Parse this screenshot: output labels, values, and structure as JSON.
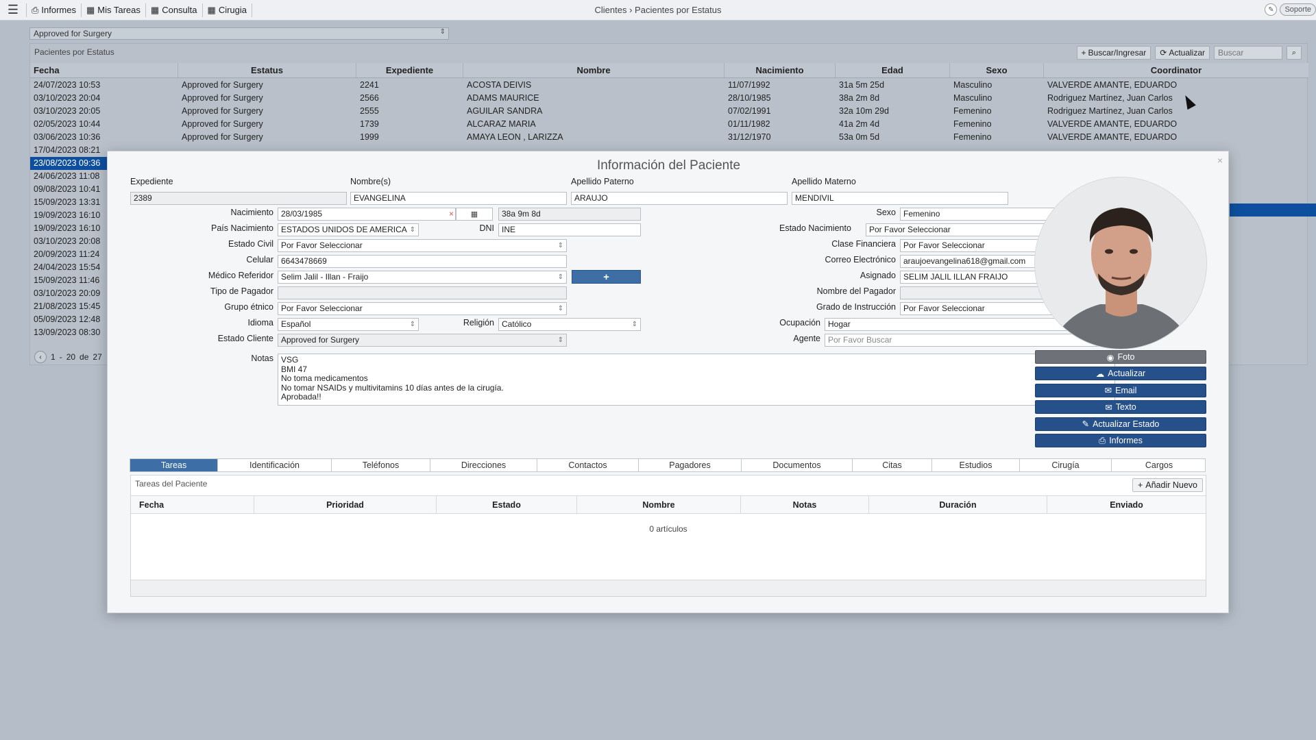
{
  "topbar": {
    "nav": [
      {
        "icon": "print-icon",
        "label": "Informes"
      },
      {
        "icon": "calendar-icon",
        "label": "Mis Tareas"
      },
      {
        "icon": "calendar-icon",
        "label": "Consulta"
      },
      {
        "icon": "calendar-icon",
        "label": "Cirugia"
      }
    ],
    "breadcrumb_parent": "Clientes",
    "breadcrumb_sep": "›",
    "breadcrumb_current": "Pacientes por Estatus",
    "support_label": "Soporte"
  },
  "status_filter": {
    "value": "Approved for Surgery"
  },
  "background_grid": {
    "title": "Pacientes por Estatus",
    "search_label": "Buscar/Ingresar",
    "refresh_label": "Actualizar",
    "search_placeholder": "Buscar",
    "columns": [
      "Fecha",
      "Estatus",
      "Expediente",
      "Nombre",
      "Nacimiento",
      "Edad",
      "Sexo",
      "Coordinator"
    ],
    "rows": [
      [
        "24/07/2023 10:53",
        "Approved for Surgery",
        "2241",
        "ACOSTA DEIVIS",
        "11/07/1992",
        "31a 5m 25d",
        "Masculino",
        "VALVERDE AMANTE, EDUARDO"
      ],
      [
        "03/10/2023 20:04",
        "Approved for Surgery",
        "2566",
        "ADAMS MAURICE",
        "28/10/1985",
        "38a 2m 8d",
        "Masculino",
        "Rodriguez Martínez, Juan Carlos"
      ],
      [
        "03/10/2023 20:05",
        "Approved for Surgery",
        "2555",
        "AGUILAR SANDRA",
        "07/02/1991",
        "32a 10m 29d",
        "Femenino",
        "Rodriguez Martínez, Juan Carlos"
      ],
      [
        "02/05/2023 10:44",
        "Approved for Surgery",
        "1739",
        "ALCARAZ MARIA",
        "01/11/1982",
        "41a 2m 4d",
        "Femenino",
        "VALVERDE AMANTE, EDUARDO"
      ],
      [
        "03/06/2023 10:36",
        "Approved for Surgery",
        "1999",
        "AMAYA LEON , LARIZZA",
        "31/12/1970",
        "53a 0m 5d",
        "Femenino",
        "VALVERDE AMANTE, EDUARDO"
      ]
    ],
    "hidden_dates": [
      "17/04/2023 08:21",
      "23/08/2023 09:36",
      "24/06/2023 11:08",
      "09/08/2023 10:41",
      "15/09/2023 13:31",
      "19/09/2023 16:10",
      "19/09/2023 16:10",
      "03/10/2023 20:08",
      "20/09/2023 11:24",
      "24/04/2023 15:54",
      "15/09/2023 11:46",
      "03/10/2023 20:09",
      "21/08/2023 15:45",
      "05/09/2023 12:48",
      "13/09/2023 08:30"
    ],
    "pager": {
      "from": "1",
      "dash": "-",
      "to": "20",
      "of_label": "de",
      "total": "27"
    }
  },
  "modal": {
    "title": "Información del Paciente",
    "labels": {
      "expediente": "Expediente",
      "nombres": "Nombre(s)",
      "apellido_paterno": "Apellido Paterno",
      "apellido_materno": "Apellido Materno",
      "nacimiento": "Nacimiento",
      "sexo": "Sexo",
      "pais_nacimiento": "País Nacimiento",
      "dni": "DNI",
      "estado_nacimiento": "Estado Nacimiento",
      "estado_civil": "Estado Civil",
      "clase_financiera": "Clase Financiera",
      "celular": "Celular",
      "correo": "Correo Electrónico",
      "medico_referidor": "Médico Referidor",
      "asignado": "Asignado",
      "tipo_pagador": "Tipo de Pagador",
      "nombre_pagador": "Nombre del Pagador",
      "grupo_etnico": "Grupo étnico",
      "grado_instruccion": "Grado de Instrucción",
      "idioma": "Idioma",
      "religion": "Religión",
      "ocupacion": "Ocupación",
      "estado_cliente": "Estado Cliente",
      "agente": "Agente",
      "notas": "Notas"
    },
    "values": {
      "expediente": "2389",
      "nombres": "EVANGELINA",
      "apellido_paterno": "ARAUJO",
      "apellido_materno": "MENDIVIL",
      "nacimiento": "28/03/1985",
      "edad": "38a 9m 8d",
      "sexo": "Femenino",
      "pais_nacimiento": "ESTADOS UNIDOS DE AMERICA",
      "dni": "INE",
      "estado_nacimiento": "Por Favor Seleccionar",
      "estado_civil": "Por Favor Seleccionar",
      "clase_financiera": "Por Favor Seleccionar",
      "celular": "6643478669",
      "correo": "araujoevangelina618@gmail.com",
      "medico_referidor": "Selim Jalil - Illan - Fraijo",
      "asignado": "SELIM JALIL ILLAN FRAIJO",
      "tipo_pagador": "",
      "nombre_pagador": "",
      "grupo_etnico": "Por Favor Seleccionar",
      "grado_instruccion": "Por Favor Seleccionar",
      "idioma": "Español",
      "religion": "Católico",
      "ocupacion": "Hogar",
      "estado_cliente": "Approved for Surgery",
      "agente_placeholder": "Por Favor Buscar",
      "notas": [
        "VSG",
        "BMI 47",
        "No toma medicamentos",
        "No tomar NSAIDs y multivitamins 10 días antes de la cirugía.",
        "Aprobada!!"
      ]
    },
    "plus_label": "+",
    "side_buttons": [
      {
        "icon": "camera-icon",
        "label": "Foto",
        "style": "grey"
      },
      {
        "icon": "cloud-upload-icon",
        "label": "Actualizar",
        "style": "blue"
      },
      {
        "icon": "envelope-icon",
        "label": "Email",
        "style": "blue"
      },
      {
        "icon": "envelope-icon",
        "label": "Texto",
        "style": "blue"
      },
      {
        "icon": "edit-icon",
        "label": "Actualizar Estado",
        "style": "blue"
      },
      {
        "icon": "print-icon",
        "label": "Informes",
        "style": "blue"
      }
    ],
    "tabs": [
      "Tareas",
      "Identificación",
      "Teléfonos",
      "Direcciones",
      "Contactos",
      "Pagadores",
      "Documentos",
      "Citas",
      "Estudios",
      "Cirugía",
      "Cargos"
    ],
    "active_tab": "Tareas",
    "tasks": {
      "title": "Tareas del Paciente",
      "add_label": "Añadir Nuevo",
      "columns": [
        "Fecha",
        "Prioridad",
        "Estado",
        "Nombre",
        "Notas",
        "Duración",
        "Enviado"
      ],
      "empty": "0 artículos"
    }
  },
  "colors": {
    "accent": "#3d6fa6",
    "button_blue": "#25508a",
    "selected_row": "#0d4f9e"
  }
}
